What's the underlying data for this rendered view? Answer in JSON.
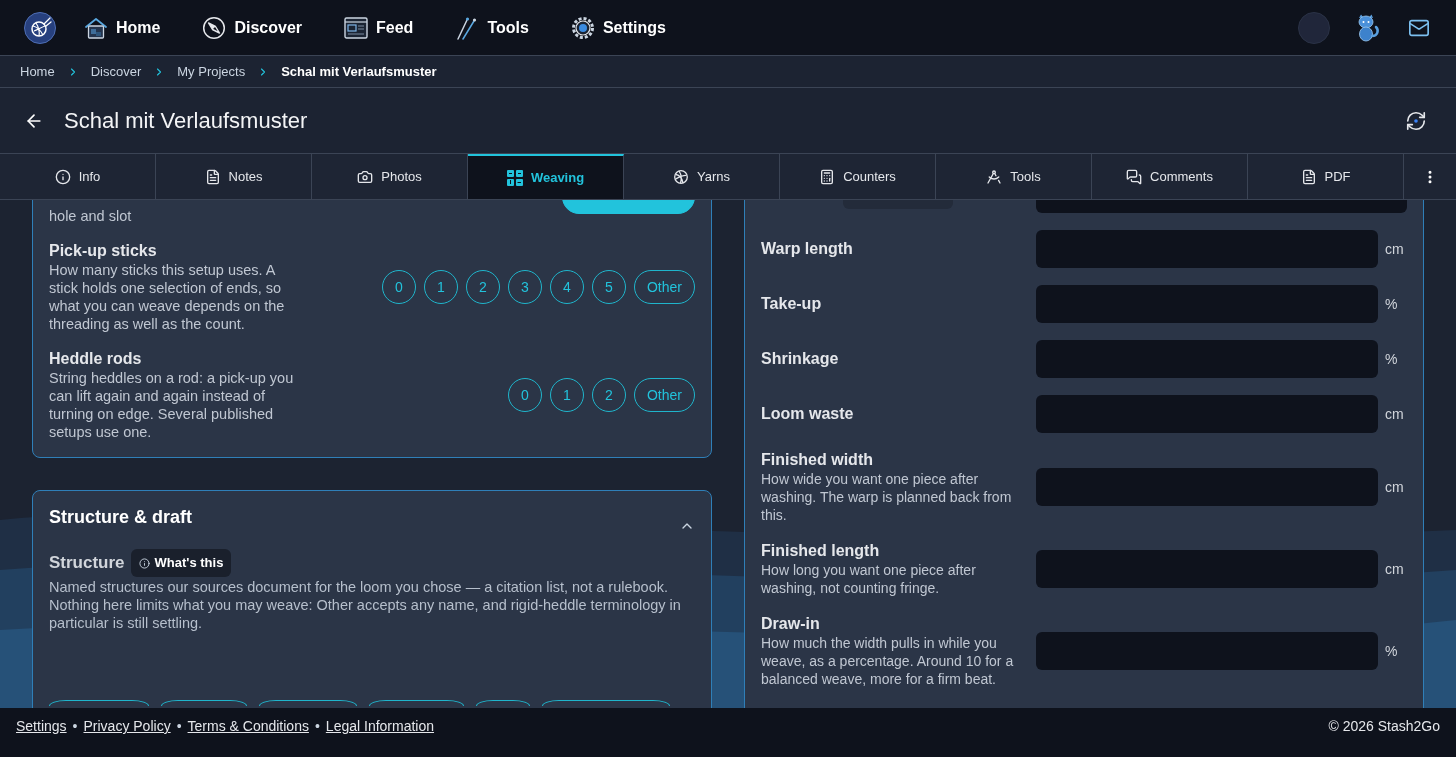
{
  "nav": {
    "items": [
      {
        "label": "Home"
      },
      {
        "label": "Discover"
      },
      {
        "label": "Feed"
      },
      {
        "label": "Tools"
      },
      {
        "label": "Settings"
      }
    ]
  },
  "breadcrumb": [
    {
      "label": "Home",
      "current": false
    },
    {
      "label": "Discover",
      "current": false
    },
    {
      "label": "My Projects",
      "current": false
    },
    {
      "label": "Schal mit Verlaufsmuster",
      "current": true
    }
  ],
  "header": {
    "title": "Schal mit Verlaufsmuster"
  },
  "tabs": [
    {
      "label": "Info",
      "selected": false
    },
    {
      "label": "Notes",
      "selected": false
    },
    {
      "label": "Photos",
      "selected": false
    },
    {
      "label": "Weaving",
      "selected": true
    },
    {
      "label": "Yarns",
      "selected": false
    },
    {
      "label": "Counters",
      "selected": false
    },
    {
      "label": "Tools",
      "selected": false
    },
    {
      "label": "Comments",
      "selected": false
    },
    {
      "label": "PDF",
      "selected": false
    }
  ],
  "setup_card": {
    "rows": [
      {
        "description": "hole and slot",
        "options": [
          {
            "selected": true
          }
        ]
      },
      {
        "title": "Pick-up sticks",
        "description": "How many sticks this setup uses. A stick holds one selection of ends, so what you can weave depends on the threading as well as the count.",
        "options": [
          {
            "label": "0",
            "selected": false
          },
          {
            "label": "1",
            "selected": false
          },
          {
            "label": "2",
            "selected": false
          },
          {
            "label": "3",
            "selected": false
          },
          {
            "label": "4",
            "selected": false
          },
          {
            "label": "5",
            "selected": false
          },
          {
            "label": "Other",
            "selected": false
          }
        ]
      },
      {
        "title": "Heddle rods",
        "description": "String heddles on a rod: a pick-up you can lift again and again instead of turning on edge. Several published setups use one.",
        "options": [
          {
            "label": "0",
            "selected": false
          },
          {
            "label": "1",
            "selected": false
          },
          {
            "label": "2",
            "selected": false
          },
          {
            "label": "Other",
            "selected": false
          }
        ]
      }
    ]
  },
  "structure_card": {
    "title": "Structure & draft",
    "expanded": true,
    "field_label": "Structure",
    "help_button": "What's this",
    "description": "Named structures our sources document for the loom you chose — a citation list, not a rulebook. Nothing here limits what you may weave: Other accepts any name, and rigid-heddle terminology in particular is still settling.",
    "options": [
      {
        "selected": false
      },
      {
        "selected": false
      },
      {
        "selected": false
      },
      {
        "selected": false
      },
      {
        "selected": false
      },
      {
        "selected": false
      }
    ]
  },
  "measurements_card": {
    "rows": [
      {
        "kind": "select_input"
      },
      {
        "kind": "input",
        "label": "Warp length",
        "unit": "cm"
      },
      {
        "kind": "input",
        "label": "Take-up",
        "unit": "%"
      },
      {
        "kind": "input",
        "label": "Shrinkage",
        "unit": "%"
      },
      {
        "kind": "input",
        "label": "Loom waste",
        "unit": "cm"
      },
      {
        "kind": "input",
        "label": "Finished width",
        "description": "How wide you want one piece after washing. The warp is planned back from this.",
        "unit": "cm"
      },
      {
        "kind": "input",
        "label": "Finished length",
        "description": "How long you want one piece after washing, not counting fringe.",
        "unit": "cm"
      },
      {
        "kind": "input",
        "label": "Draw-in",
        "description": "How much the width pulls in while you weave, as a percentage. Around 10 for a balanced weave, more for a firm beat.",
        "unit": "%"
      }
    ]
  },
  "footer": {
    "links": [
      "Settings",
      "Privacy Policy",
      "Terms & Conditions",
      "Legal Information"
    ],
    "separator": "•",
    "copyright": "© 2026 Stash2Go"
  }
}
